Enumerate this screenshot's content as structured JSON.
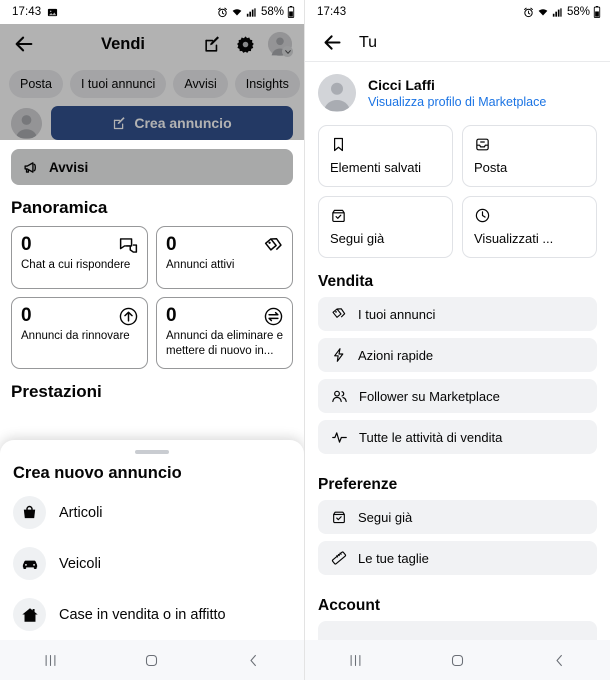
{
  "status_bar": {
    "time": "17:43",
    "battery_percent": "58%",
    "icons": [
      "image-icon",
      "alarm-icon",
      "wifi-icon",
      "cellular-signal-icon",
      "battery-icon"
    ]
  },
  "left_screen": {
    "header": {
      "back_icon": "back-arrow-icon",
      "title": "Vendi",
      "compose_icon": "compose-icon",
      "settings_icon": "gear-icon",
      "avatar_icon": "avatar-icon",
      "chevron_icon": "chevron-down-icon"
    },
    "chips": [
      "Posta",
      "I tuoi annunci",
      "Avvisi",
      "Insights"
    ],
    "create_button": {
      "label": "Crea annuncio",
      "icon": "compose-icon",
      "color": "#1b53c4"
    },
    "alerts_row": {
      "label": "Avvisi",
      "icon": "megaphone-icon"
    },
    "overview": {
      "title": "Panoramica",
      "cards": [
        {
          "value": "0",
          "label": "Chat a cui rispondere",
          "icon": "chat-bubbles-icon"
        },
        {
          "value": "0",
          "label": "Annunci attivi",
          "icon": "price-tag-icon"
        },
        {
          "value": "0",
          "label": "Annunci da rinnovare",
          "icon": "arrow-up-circle-icon"
        },
        {
          "value": "0",
          "label": "Annunci da eliminare e mettere di nuovo in...",
          "icon": "swap-circle-icon"
        }
      ]
    },
    "performance_title": "Prestazioni",
    "bottom_sheet": {
      "title": "Crea nuovo annuncio",
      "items": [
        {
          "label": "Articoli",
          "icon": "bag-icon"
        },
        {
          "label": "Veicoli",
          "icon": "car-icon"
        },
        {
          "label": "Case in vendita o in affitto",
          "icon": "house-icon"
        }
      ]
    }
  },
  "right_screen": {
    "header": {
      "back_icon": "back-arrow-icon",
      "title": "Tu"
    },
    "profile": {
      "name": "Cicci Laffi",
      "link": "Visualizza profilo di Marketplace",
      "avatar_icon": "avatar-icon",
      "link_color": "#1b74e4"
    },
    "tiles": [
      {
        "label": "Elementi salvati",
        "icon": "bookmark-icon"
      },
      {
        "label": "Posta",
        "icon": "inbox-icon"
      },
      {
        "label": "Segui già",
        "icon": "box-check-icon"
      },
      {
        "label": "Visualizzati ...",
        "icon": "clock-icon"
      }
    ],
    "sections": [
      {
        "title": "Vendita",
        "items": [
          {
            "label": "I tuoi annunci",
            "icon": "price-tag-icon"
          },
          {
            "label": "Azioni rapide",
            "icon": "lightning-icon"
          },
          {
            "label": "Follower su Marketplace",
            "icon": "people-icon"
          },
          {
            "label": "Tutte le attività di vendita",
            "icon": "activity-pulse-icon"
          }
        ]
      },
      {
        "title": "Preferenze",
        "items": [
          {
            "label": "Segui già",
            "icon": "box-check-icon"
          },
          {
            "label": "Le tue taglie",
            "icon": "ruler-icon"
          }
        ]
      },
      {
        "title": "Account",
        "items": []
      }
    ]
  },
  "nav_bar": {
    "recents_icon": "recents-icon",
    "home_icon": "home-icon",
    "back_icon": "nav-back-icon"
  }
}
